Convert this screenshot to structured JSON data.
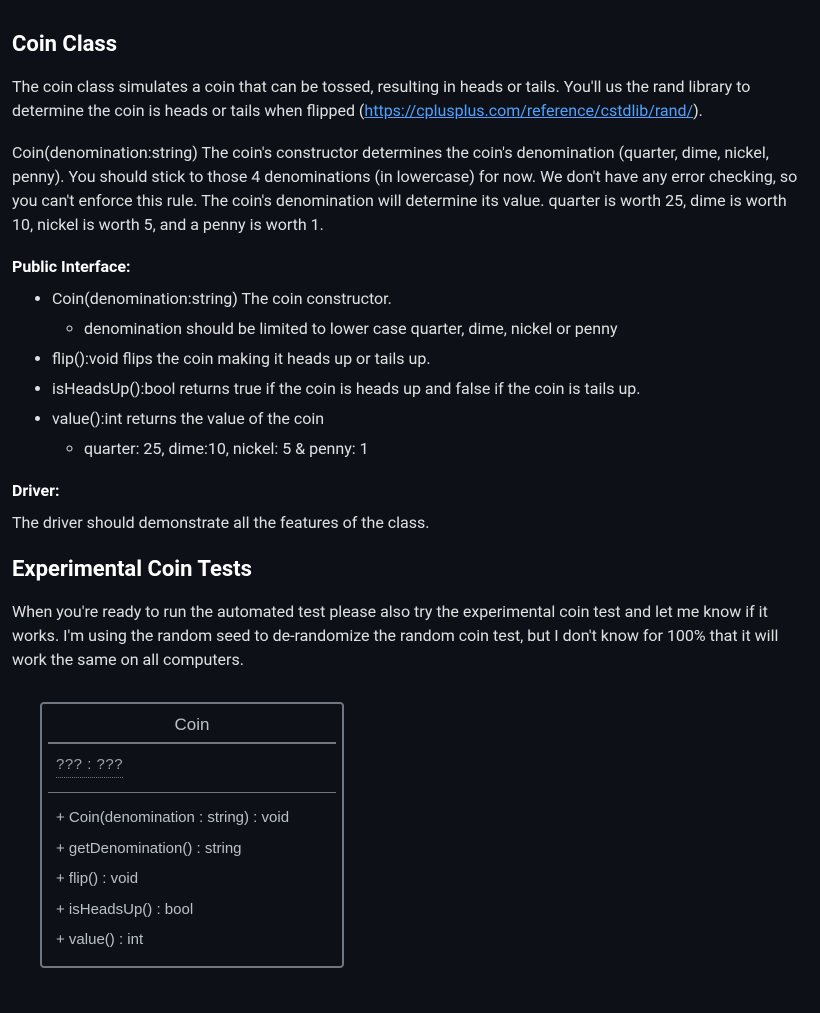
{
  "heading1": "Coin Class",
  "para1_a": "The coin class simulates a coin that can be tossed, resulting in heads or tails. You'll us the rand library to determine the coin is heads or tails when flipped (",
  "para1_link_text": "https://cplusplus.com/reference/cstdlib/rand/",
  "para1_link_href": "https://cplusplus.com/reference/cstdlib/rand/",
  "para1_b": ").",
  "para2": "Coin(denomination:string) The coin's constructor determines the coin's denomination (quarter, dime, nickel, penny). You should stick to those 4 denominations (in lowercase) for now. We don't have any error checking, so you can't enforce this rule. The coin's denomination will determine its value. quarter is worth 25, dime is worth 10, nickel is worth 5, and a penny is worth 1.",
  "public_interface_label": "Public Interface:",
  "bullets": {
    "b1": "Coin(denomination:string) The coin constructor.",
    "b1_sub": "denomination should be limited to lower case quarter, dime, nickel or penny",
    "b2": "flip():void flips the coin making it heads up or tails up.",
    "b3": "isHeadsUp():bool returns true if the coin is heads up and false if the coin is tails up.",
    "b4": "value():int returns the value of the coin",
    "b4_sub": "quarter: 25, dime:10, nickel: 5 & penny: 1"
  },
  "driver_label": "Driver:",
  "driver_text": "The driver should demonstrate all the features of the class.",
  "heading2": "Experimental Coin Tests",
  "para3": "When you're ready to run the automated test please also try the experimental coin test and let me know if it works. I'm using the random seed to de-randomize the random coin test, but I don't know for 100% that it will work the same on all computers.",
  "uml": {
    "title": "Coin",
    "attr": "??? : ???",
    "m1": "+ Coin(denomination : string) : void",
    "m2": "+ getDenomination() : string",
    "m3": "+ flip() : void",
    "m4": "+ isHeadsUp() : bool",
    "m5": "+ value() : int"
  }
}
